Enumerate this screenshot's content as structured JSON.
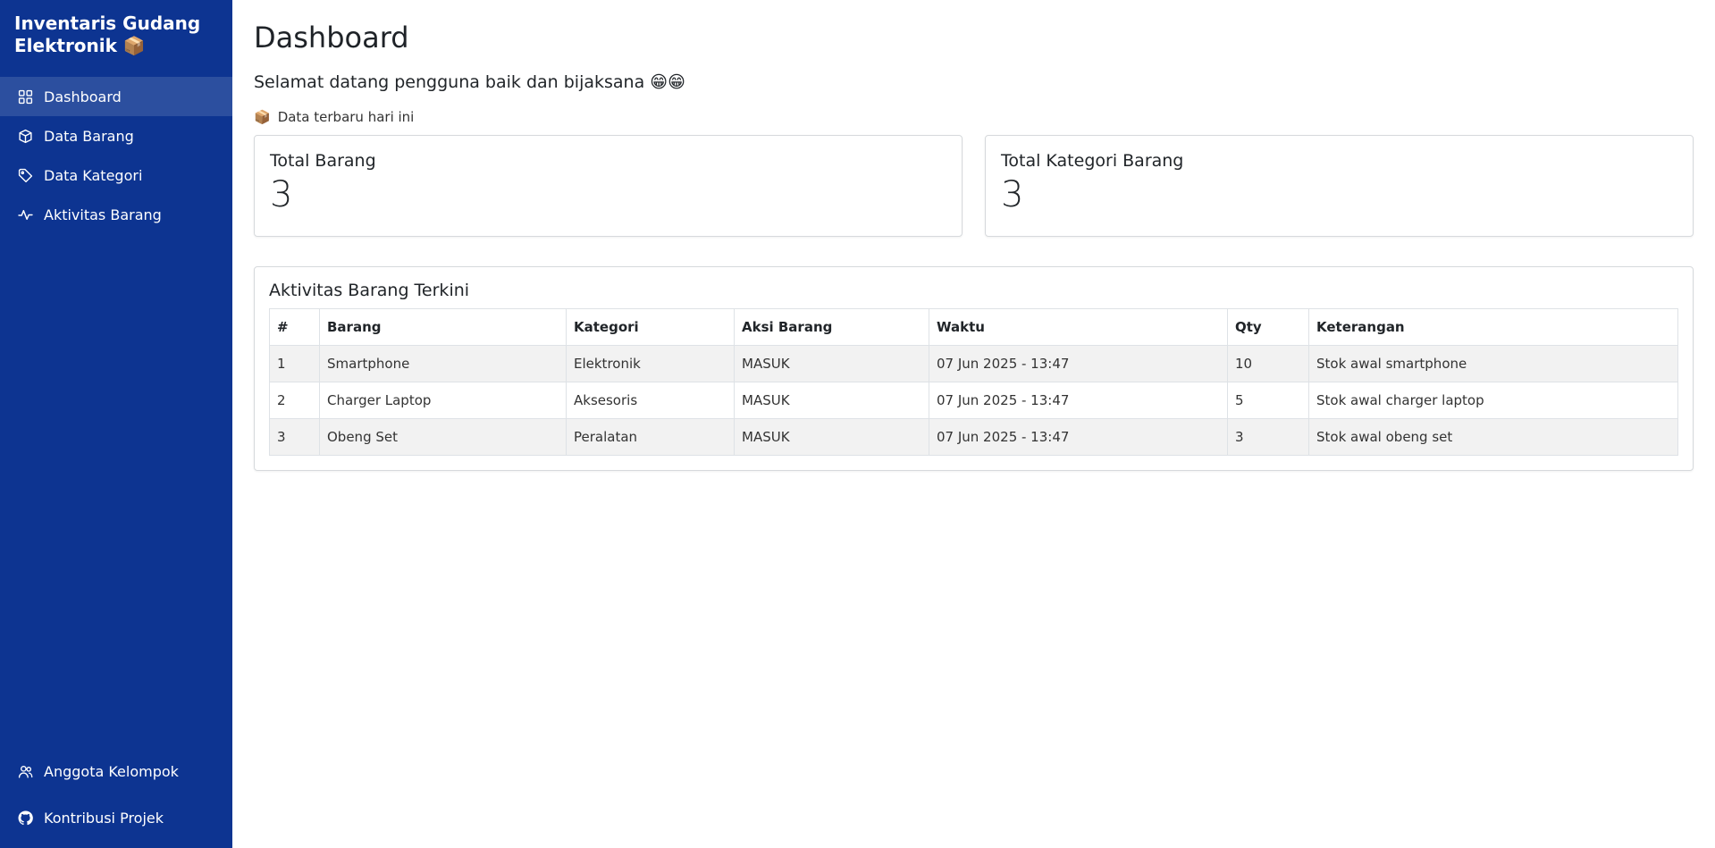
{
  "sidebar": {
    "brand_line1": "Inventaris Gudang",
    "brand_line2": "Elektronik 📦",
    "items": [
      {
        "label": "Dashboard",
        "icon": "grid-icon",
        "active": true
      },
      {
        "label": "Data Barang",
        "icon": "box-icon"
      },
      {
        "label": "Data Kategori",
        "icon": "tag-icon"
      },
      {
        "label": "Aktivitas Barang",
        "icon": "activity-icon"
      }
    ],
    "bottom_items": [
      {
        "label": "Anggota Kelompok",
        "icon": "users-icon"
      },
      {
        "label": "Kontribusi Projek",
        "icon": "github-icon"
      }
    ]
  },
  "main": {
    "title": "Dashboard",
    "welcome": "Selamat datang pengguna baik dan bijaksana 😁😁",
    "subtitle": "Data terbaru hari ini",
    "subtitle_emoji": "📦",
    "cards": [
      {
        "title": "Total Barang",
        "value": "3"
      },
      {
        "title": "Total Kategori Barang",
        "value": "3"
      }
    ],
    "activity": {
      "title": "Aktivitas Barang Terkini",
      "columns": [
        "#",
        "Barang",
        "Kategori",
        "Aksi Barang",
        "Waktu",
        "Qty",
        "Keterangan"
      ],
      "rows": [
        [
          "1",
          "Smartphone",
          "Elektronik",
          "MASUK",
          "07 Jun 2025 - 13:47",
          "10",
          "Stok awal smartphone"
        ],
        [
          "2",
          "Charger Laptop",
          "Aksesoris",
          "MASUK",
          "07 Jun 2025 - 13:47",
          "5",
          "Stok awal charger laptop"
        ],
        [
          "3",
          "Obeng Set",
          "Peralatan",
          "MASUK",
          "07 Jun 2025 - 13:47",
          "3",
          "Stok awal obeng set"
        ]
      ]
    }
  }
}
